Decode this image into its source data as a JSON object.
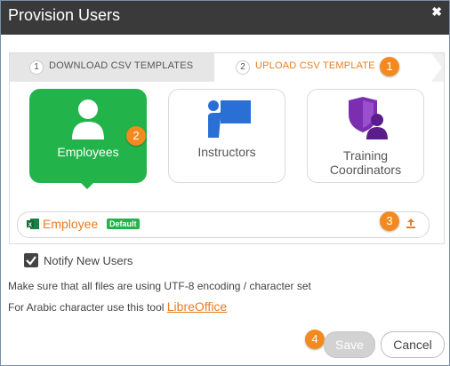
{
  "window": {
    "title": "Provision Users"
  },
  "steps": [
    {
      "number": "1",
      "label": "DOWNLOAD CSV TEMPLATES",
      "active": false
    },
    {
      "number": "2",
      "label": "UPLOAD CSV TEMPLATE",
      "active": true
    }
  ],
  "callouts": [
    "1",
    "2",
    "3",
    "4"
  ],
  "roles": [
    {
      "label": "Employees",
      "icon": "person-icon",
      "selected": true
    },
    {
      "label": "Instructors",
      "icon": "instructor-icon",
      "selected": false
    },
    {
      "label": "Training Coordinators",
      "icon": "coordinator-shield-icon",
      "selected": false
    }
  ],
  "file": {
    "name": "Employee",
    "tag": "Default",
    "icon": "excel-icon"
  },
  "notify": {
    "label": "Notify New Users",
    "checked": true
  },
  "notes": {
    "encoding": "Make sure that all files are using UTF-8 encoding / character set",
    "arabic_prefix": "For Arabic character use this tool",
    "arabic_link": "LibreOffice"
  },
  "buttons": {
    "save": "Save",
    "cancel": "Cancel"
  },
  "colors": {
    "accent": "#f28a1f",
    "selected_green": "#22b44a",
    "title_bar": "#3a3a3a"
  }
}
